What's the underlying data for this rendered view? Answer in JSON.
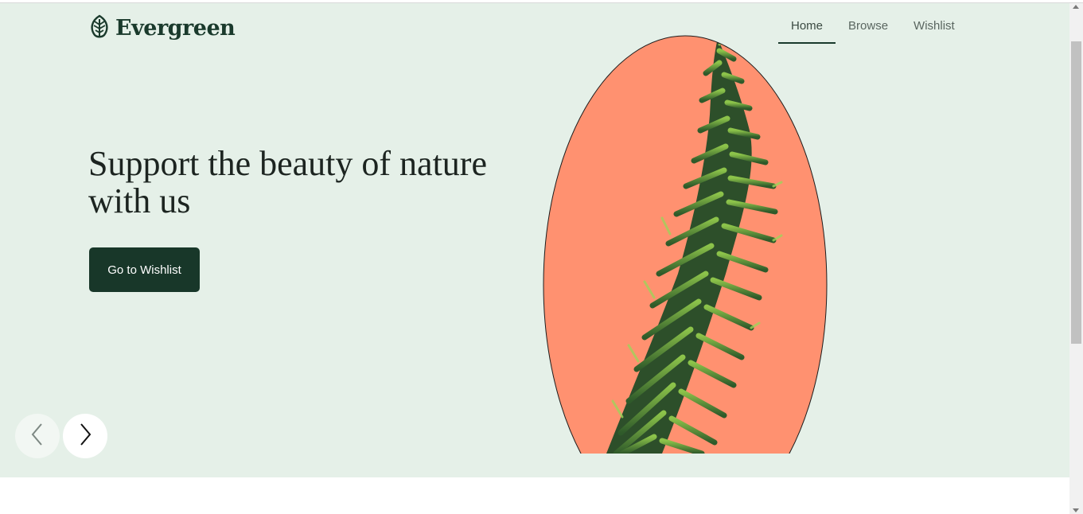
{
  "brand": {
    "name": "Evergreen",
    "logo_icon": "leaf-icon",
    "color": "#1a3a2c"
  },
  "nav": {
    "items": [
      {
        "label": "Home",
        "active": true
      },
      {
        "label": "Browse",
        "active": false
      },
      {
        "label": "Wishlist",
        "active": false
      }
    ]
  },
  "hero": {
    "headline": "Support the beauty of nature with us",
    "cta_label": "Go to Wishlist",
    "background": "#e5f0e8",
    "image_accent": "#ff9170",
    "image_icon": "plant-branch-image"
  },
  "carousel": {
    "prev_icon": "chevron-left-icon",
    "next_icon": "chevron-right-icon"
  },
  "colors": {
    "primary": "#183729",
    "accent": "#ff9170"
  }
}
